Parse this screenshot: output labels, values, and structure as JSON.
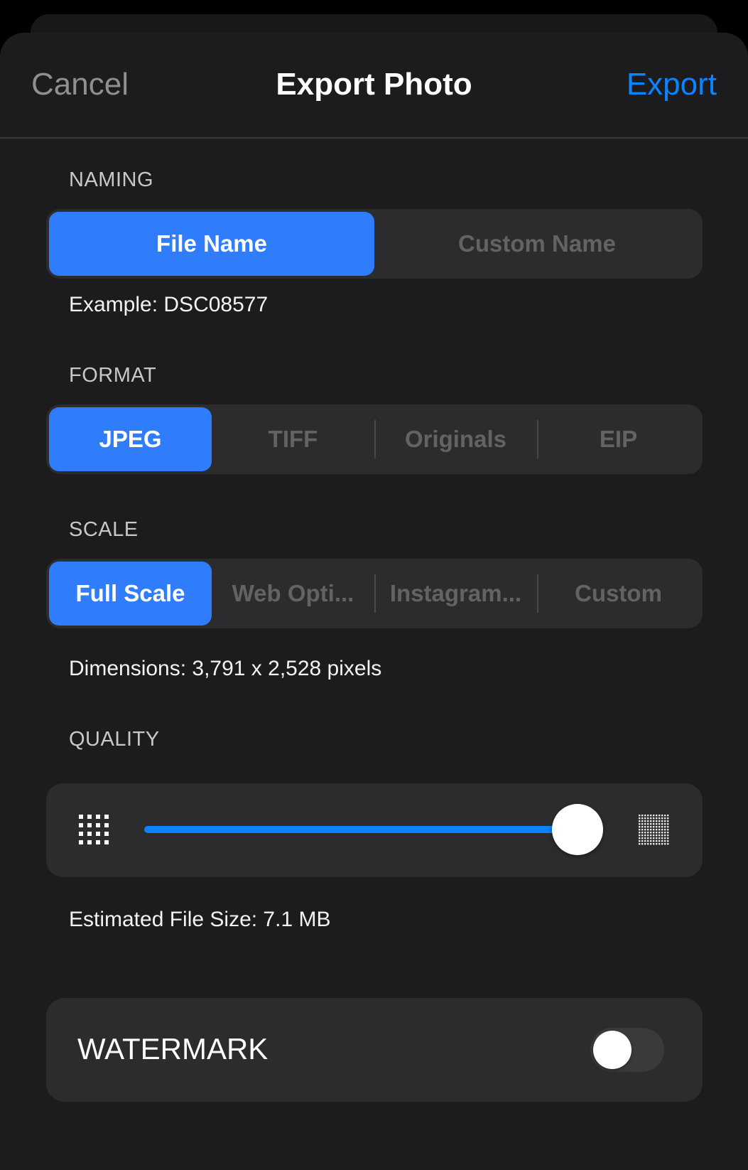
{
  "nav": {
    "cancel_label": "Cancel",
    "title": "Export Photo",
    "export_label": "Export"
  },
  "naming": {
    "section_label": "NAMING",
    "options": [
      "File Name",
      "Custom Name"
    ],
    "selected_index": 0,
    "example_text": "Example: DSC08577"
  },
  "format": {
    "section_label": "FORMAT",
    "options": [
      "JPEG",
      "TIFF",
      "Originals",
      "EIP"
    ],
    "selected_index": 0
  },
  "scale": {
    "section_label": "SCALE",
    "options": [
      "Full Scale",
      "Web Opti...",
      "Instagram...",
      "Custom"
    ],
    "selected_index": 0,
    "dimensions_text": "Dimensions: 3,791 x 2,528 pixels"
  },
  "quality": {
    "section_label": "QUALITY",
    "value": 1.0,
    "min_icon": "low-quality-grid-icon",
    "max_icon": "high-quality-grid-icon",
    "file_size_text": "Estimated File Size: 7.1 MB"
  },
  "watermark": {
    "label": "WATERMARK",
    "enabled": false
  },
  "colors": {
    "accent": "#0a84ff",
    "segment_active": "#2f7dfb",
    "background": "#1c1c1e",
    "card": "#2c2c2e"
  }
}
